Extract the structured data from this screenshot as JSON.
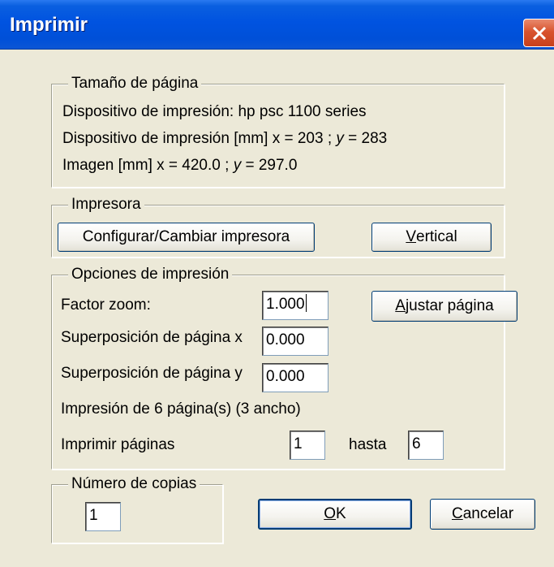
{
  "window": {
    "title": "Imprimir"
  },
  "page_size": {
    "legend": "Tamaño de página",
    "device_line": "Dispositivo de impresión: hp psc 1100 series",
    "device_mm_prefix": "Dispositivo de impresión [mm]  x = 203 ; ",
    "device_mm_y": "y",
    "device_mm_suffix": " = 283",
    "image_prefix": "Imagen [mm] x = 420.0 ; ",
    "image_y": "y",
    "image_suffix": " = 297.0"
  },
  "printer": {
    "legend": "Impresora",
    "configure_button": "Configurar/Cambiar impresora",
    "orientation_button_mnemonic": "V",
    "orientation_button_rest": "ertical"
  },
  "print_options": {
    "legend": "Opciones de impresión",
    "zoom_label": "Factor zoom:",
    "zoom_value": "1.000",
    "fit_button_mnemonic": "A",
    "fit_button_rest": "justar página",
    "overlap_x_label": "Superposición de página x",
    "overlap_x_value": "0.000",
    "overlap_y_label": "Superposición de página y",
    "overlap_y_value": "0.000",
    "pages_info": "Impresión de 6 página(s) (3 ancho)",
    "print_pages_label": "Imprimir páginas",
    "from_value": "1",
    "to_label": "hasta",
    "to_value": "6"
  },
  "copies": {
    "legend": "Número de copias",
    "value": "1"
  },
  "footer": {
    "ok_mnemonic": "O",
    "ok_rest": "K",
    "cancel_mnemonic": "C",
    "cancel_rest": "ancelar"
  }
}
